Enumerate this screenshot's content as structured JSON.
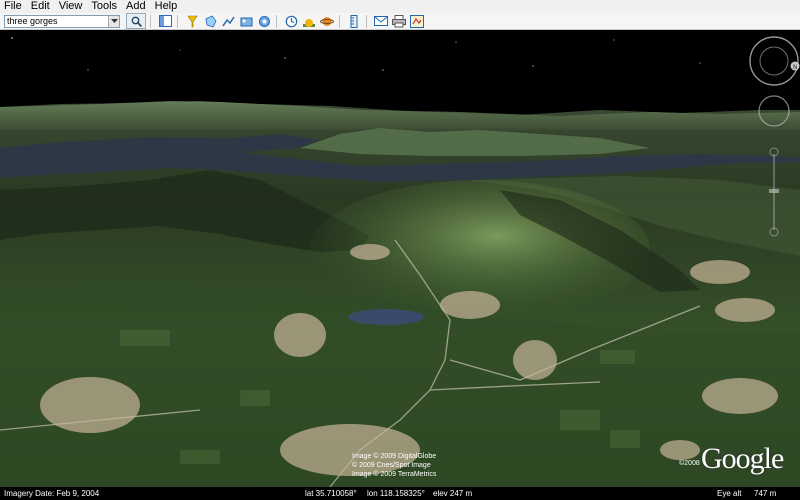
{
  "menu": [
    "File",
    "Edit",
    "View",
    "Tools",
    "Add",
    "Help"
  ],
  "search": {
    "value": "three gorges"
  },
  "toolbar_icons": [
    "sidebar-icon",
    "placemark-icon",
    "polygon-icon",
    "path-icon",
    "image-overlay-icon",
    "record-tour-icon",
    "historical-imagery-icon",
    "sunlight-icon",
    "planets-icon",
    "ruler-icon",
    "email-icon",
    "print-icon",
    "view-in-maps-icon"
  ],
  "attribution": [
    "Image © 2009 DigitalGlobe",
    "© 2009 Cnes/Spot Image",
    "Image © 2009 TerraMetrics"
  ],
  "copyright_year": "©2008",
  "logo": "Google",
  "status": {
    "imagery_date": "Imagery Date: Feb 9, 2004",
    "lat": "lat  35.710058°",
    "lon": "lon  118.158325°",
    "elev": "elev  247 m",
    "eye_alt_label": "Eye alt",
    "eye_alt_value": "747 m"
  },
  "colors": {
    "sky": "#000000",
    "terrain_dark": "#2c3a22",
    "terrain_light": "#6f8a4e",
    "lake": "#2b3540"
  }
}
